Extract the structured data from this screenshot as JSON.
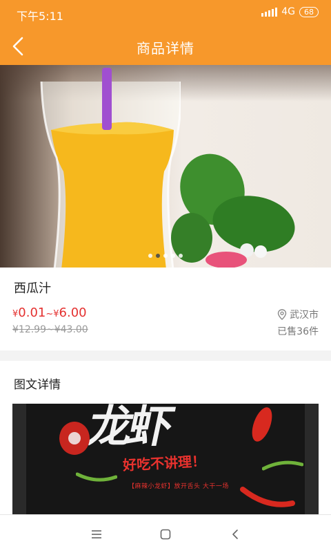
{
  "status_bar": {
    "time": "下午5:11",
    "network": "4G",
    "battery": "68"
  },
  "nav": {
    "title": "商品详情",
    "back_icon": "chevron-left-icon"
  },
  "carousel": {
    "slide_count": 5,
    "active_index": 1
  },
  "product": {
    "name": "西瓜汁",
    "price_min_symbol": "¥",
    "price_min": "0.01",
    "price_separator": "~",
    "price_max_symbol": "¥",
    "price_max": "6.00",
    "original_price": "¥12.99~¥43.00",
    "location": "武汉市",
    "sold": "已售36件"
  },
  "detail": {
    "title": "图文详情",
    "poster_brush": "龙虾",
    "poster_slogan": "好吃不讲理！",
    "poster_sub": "【麻辣小龙虾】放开舌头 大干一场"
  },
  "colors": {
    "brand": "#f7982b",
    "price": "#e43130"
  },
  "system_nav": {
    "menu_icon": "menu-icon",
    "home_icon": "home-square-icon",
    "back_icon": "back-triangle-icon"
  }
}
